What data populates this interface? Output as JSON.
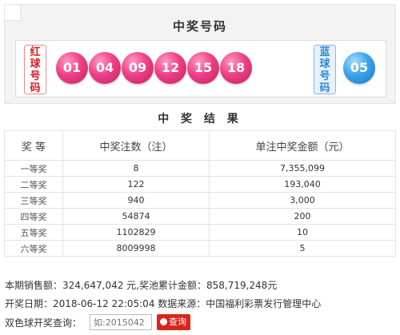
{
  "draw": {
    "title": "中奖号码",
    "red_label": [
      "红",
      "球",
      "号",
      "码"
    ],
    "blue_label": [
      "蓝",
      "球",
      "号",
      "码"
    ],
    "red_balls": [
      "01",
      "04",
      "09",
      "12",
      "15",
      "18"
    ],
    "blue_balls": [
      "05"
    ],
    "colors": {
      "red_ball": "#e8377c",
      "blue_ball": "#2f94de",
      "query_button": "#d9251c"
    }
  },
  "results": {
    "title": "中 奖 结 果",
    "headers": [
      "奖  等",
      "中奖注数（注）",
      "单注中奖金额（元）"
    ],
    "rows": [
      {
        "level": "一等奖",
        "count": "8",
        "amount": "7,355,099"
      },
      {
        "level": "二等奖",
        "count": "122",
        "amount": "193,040"
      },
      {
        "level": "三等奖",
        "count": "940",
        "amount": "3,000"
      },
      {
        "level": "四等奖",
        "count": "54874",
        "amount": "200"
      },
      {
        "level": "五等奖",
        "count": "1102829",
        "amount": "10"
      },
      {
        "level": "六等奖",
        "count": "8009998",
        "amount": "5"
      }
    ]
  },
  "info": {
    "sales_line": "本期销售额：324,647,042 元,奖池累计金额：858,719,248元",
    "date_line": "开奖日期：2018-06-12 22:05:04  数据来源：中国福利彩票发行管理中心",
    "query_label": "双色球开奖查询：",
    "query_placeholder": "如:2015042",
    "query_button": "查询",
    "query_icon": "search-icon"
  }
}
